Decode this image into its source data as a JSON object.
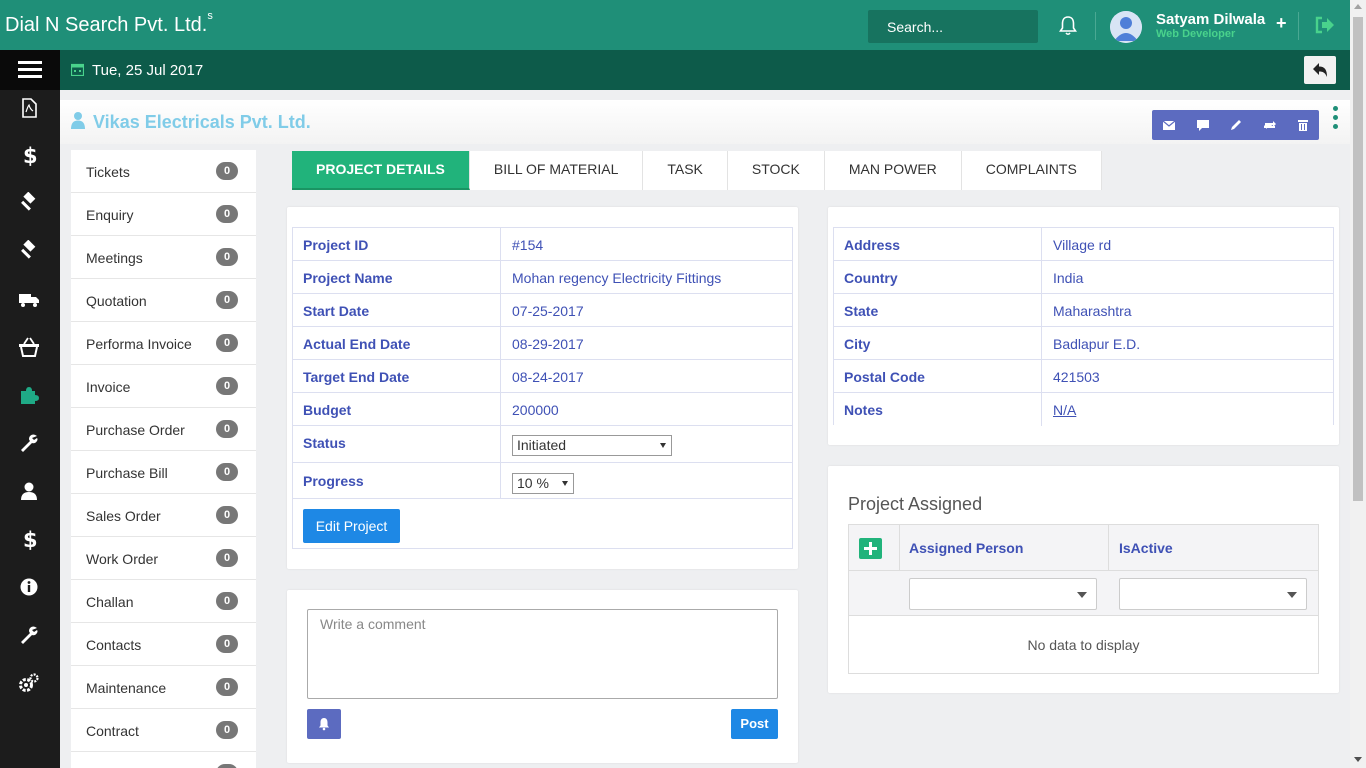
{
  "header": {
    "brand": "Dial N Search Pvt. Ltd.",
    "brand_sup": "s",
    "search_placeholder": "Search...",
    "user_name": "Satyam Dilwala",
    "user_role": "Web Developer"
  },
  "subbar": {
    "date": "Tue, 25 Jul 2017"
  },
  "company": {
    "name": "Vikas Electricals Pvt. Ltd."
  },
  "modules": [
    {
      "label": "Tickets",
      "count": "0"
    },
    {
      "label": "Enquiry",
      "count": "0"
    },
    {
      "label": "Meetings",
      "count": "0"
    },
    {
      "label": "Quotation",
      "count": "0"
    },
    {
      "label": "Performa Invoice",
      "count": "0"
    },
    {
      "label": "Invoice",
      "count": "0"
    },
    {
      "label": "Purchase Order",
      "count": "0"
    },
    {
      "label": "Purchase Bill",
      "count": "0"
    },
    {
      "label": "Sales Order",
      "count": "0"
    },
    {
      "label": "Work Order",
      "count": "0"
    },
    {
      "label": "Challan",
      "count": "0"
    },
    {
      "label": "Contacts",
      "count": "0"
    },
    {
      "label": "Maintenance",
      "count": "0"
    },
    {
      "label": "Contract",
      "count": "0"
    }
  ],
  "tabs": [
    "PROJECT DETAILS",
    "BILL OF MATERIAL",
    "TASK",
    "STOCK",
    "MAN POWER",
    "COMPLAINTS"
  ],
  "project": {
    "id_label": "Project ID",
    "id": "#154",
    "name_label": "Project Name",
    "name": "Mohan regency Electricity Fittings",
    "start_label": "Start Date",
    "start": "07-25-2017",
    "actual_end_label": "Actual End Date",
    "actual_end": "08-29-2017",
    "target_end_label": "Target End Date",
    "target_end": "08-24-2017",
    "budget_label": "Budget",
    "budget": "200000",
    "status_label": "Status",
    "status": "Initiated",
    "progress_label": "Progress",
    "progress": "10 %",
    "edit_button": "Edit Project"
  },
  "address": {
    "address_label": "Address",
    "address": "Village rd",
    "country_label": "Country",
    "country": "India",
    "state_label": "State",
    "state": "Maharashtra",
    "city_label": "City",
    "city": "Badlapur E.D.",
    "postal_label": "Postal Code",
    "postal": "421503",
    "notes_label": "Notes",
    "notes": "N/A"
  },
  "comment": {
    "placeholder": "Write a comment",
    "post_button": "Post"
  },
  "assigned": {
    "title": "Project Assigned",
    "col_person": "Assigned Person",
    "col_active": "IsActive",
    "empty": "No data to display"
  },
  "colors": {
    "primary": "#1f8f78",
    "dark": "#0d5b4a",
    "accent": "#21b37b",
    "indigo": "#3f51b5",
    "action": "#5c6bc0"
  }
}
